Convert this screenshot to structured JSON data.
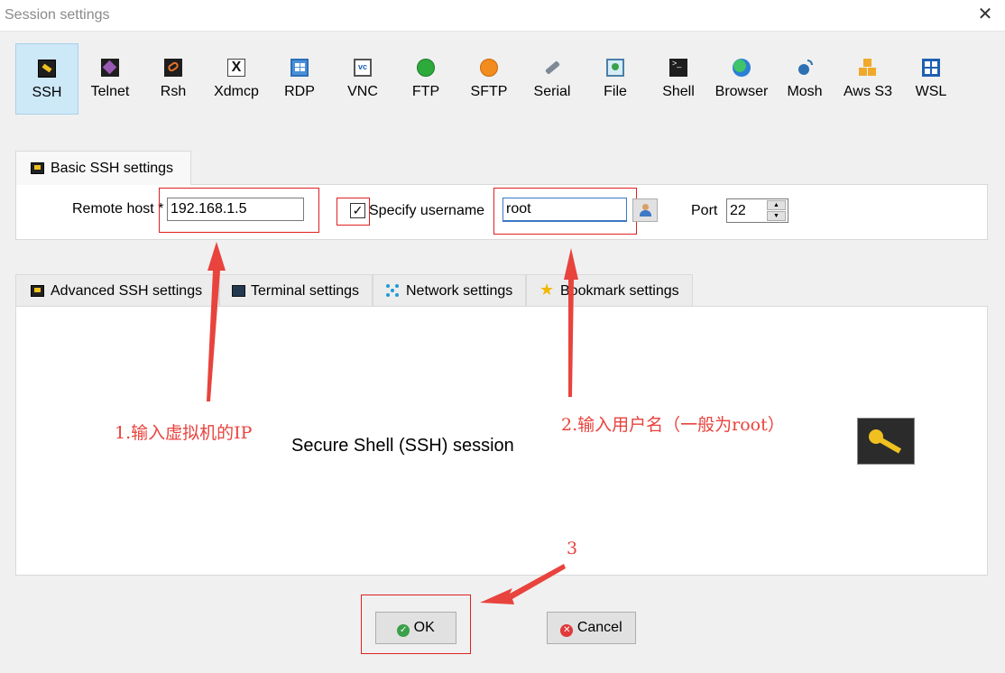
{
  "window": {
    "title": "Session settings"
  },
  "protocols": [
    {
      "label": "SSH",
      "icon": "ssh-key-icon",
      "active": true
    },
    {
      "label": "Telnet",
      "icon": "telnet-icon"
    },
    {
      "label": "Rsh",
      "icon": "rsh-icon"
    },
    {
      "label": "Xdmcp",
      "icon": "xdmcp-icon"
    },
    {
      "label": "RDP",
      "icon": "rdp-icon"
    },
    {
      "label": "VNC",
      "icon": "vnc-icon"
    },
    {
      "label": "FTP",
      "icon": "ftp-globe-icon"
    },
    {
      "label": "SFTP",
      "icon": "sftp-globe-icon"
    },
    {
      "label": "Serial",
      "icon": "serial-plug-icon"
    },
    {
      "label": "File",
      "icon": "file-monitor-icon"
    },
    {
      "label": "Shell",
      "icon": "shell-terminal-icon"
    },
    {
      "label": "Browser",
      "icon": "browser-globe-icon"
    },
    {
      "label": "Mosh",
      "icon": "mosh-antenna-icon"
    },
    {
      "label": "Aws S3",
      "icon": "aws-s3-icon"
    },
    {
      "label": "WSL",
      "icon": "wsl-windows-icon"
    }
  ],
  "basic": {
    "tab_label": "Basic SSH settings",
    "remote_host_label": "Remote host *",
    "remote_host_value": "192.168.1.5",
    "specify_username_label": "Specify username",
    "username_value": "root",
    "port_label": "Port",
    "port_value": "22"
  },
  "tabs": [
    {
      "label": "Advanced SSH settings",
      "icon": "ssh-key-icon"
    },
    {
      "label": "Terminal settings",
      "icon": "terminal-icon"
    },
    {
      "label": "Network settings",
      "icon": "network-icon"
    },
    {
      "label": "Bookmark settings",
      "icon": "star-icon"
    }
  ],
  "session_description": "Secure Shell (SSH) session",
  "buttons": {
    "ok": "OK",
    "cancel": "Cancel"
  },
  "annotations": {
    "step1": "1.输入虚拟机的IP",
    "step2": "2.输入用户名（一般为root）",
    "step3": "3"
  },
  "colors": {
    "annotation_red": "#e8433d",
    "active_tab_bg": "#cde8f7"
  }
}
